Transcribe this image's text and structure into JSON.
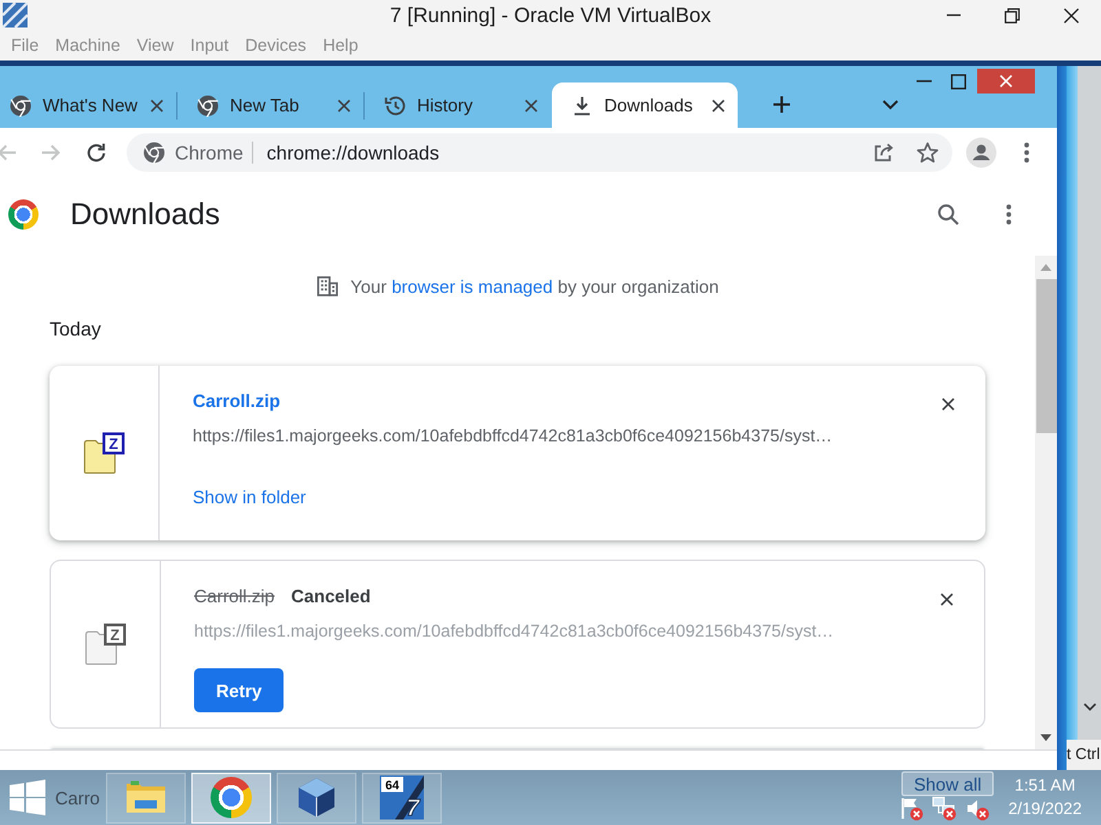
{
  "window": {
    "title": "7 [Running] - Oracle VM VirtualBox"
  },
  "menu": [
    {
      "label": "File",
      "disabled": true
    },
    {
      "label": "Machine",
      "disabled": true
    },
    {
      "label": "View",
      "disabled": true
    },
    {
      "label": "Input",
      "disabled": true
    },
    {
      "label": "Devices",
      "disabled": true
    },
    {
      "label": "Help",
      "disabled": true
    }
  ],
  "browser": {
    "tabs": [
      {
        "kind": "chrome",
        "label": "What's New",
        "selected": false
      },
      {
        "kind": "chrome",
        "label": "New Tab",
        "selected": false
      },
      {
        "kind": "history",
        "label": "History",
        "selected": false
      },
      {
        "kind": "download",
        "label": "Downloads",
        "selected": true
      }
    ],
    "toolbar": {
      "back": {
        "disabled": true
      },
      "forward": {
        "disabled": true
      }
    },
    "omnibox": {
      "chip": "Chrome",
      "url": "chrome://downloads"
    },
    "page": {
      "title": "Downloads",
      "notice": {
        "text_before": "Your",
        "link": "browser is managed",
        "text_after": "by your organization"
      },
      "section": "Today",
      "downloads": [
        {
          "kind": "completed",
          "badge": "Z",
          "name": "Carroll.zip",
          "url": "https://files1.majorgeeks.com/10afebdbffcd4742c81a3cb0f6ce4092156b4375/syst…",
          "action": "Show in folder"
        },
        {
          "kind": "canceled",
          "badge": "Z",
          "name": "Carroll.zip",
          "status": "Canceled",
          "url": "https://files1.majorgeeks.com/10afebdbffcd4742c81a3cb0f6ce4092156b4375/syst…",
          "action": "Retry"
        }
      ],
      "more_below": true
    }
  },
  "side_panel": {
    "host_key": "t Ctrl"
  },
  "taskbar": {
    "ghost_label": "Carro",
    "apps": [
      {
        "kind": "explorer",
        "selected": false
      },
      {
        "kind": "chrome",
        "selected": true
      },
      {
        "kind": "virtualbox",
        "selected": false
      },
      {
        "kind": "windows7",
        "badge": "64",
        "label": "7",
        "selected": false
      }
    ],
    "show_all": "Show all",
    "tray": [
      {
        "kind": "flag",
        "error": true
      },
      {
        "kind": "network",
        "error": true
      },
      {
        "kind": "speaker",
        "error": true
      }
    ],
    "clock": {
      "time": "1:51 AM",
      "date": "2/19/2022"
    }
  }
}
